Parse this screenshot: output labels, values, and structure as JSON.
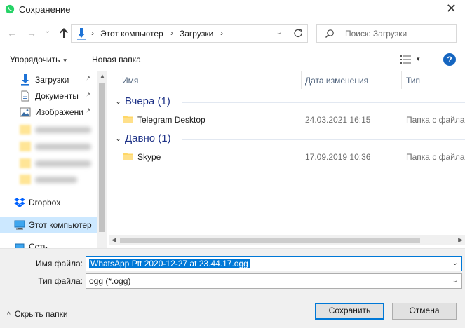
{
  "window": {
    "title": "Сохранение",
    "close_glyph": "✕",
    "app_icon": "whatsapp-icon"
  },
  "nav": {
    "back_glyph": "←",
    "forward_glyph": "→",
    "history_glyph": "⌄",
    "up_icon": "arrow-up-icon",
    "breadcrumb_sep": "›",
    "breadcrumbs": [
      "Этот компьютер",
      "Загрузки"
    ],
    "address_dropdown_glyph": "⌄",
    "search_placeholder": "Поиск: Загрузки"
  },
  "toolbar": {
    "organize_label": "Упорядочить",
    "new_folder_label": "Новая папка",
    "dropdown_glyph": "▾",
    "help_label": "?"
  },
  "sidebar": {
    "quick_access": [
      {
        "label": "Загрузки",
        "icon": "download-arrow-icon",
        "pinned": true
      },
      {
        "label": "Документы",
        "icon": "document-icon",
        "pinned": true
      },
      {
        "label": "Изображени",
        "icon": "picture-icon",
        "pinned": true
      }
    ],
    "pin_glyph": "📌",
    "dropbox_label": "Dropbox",
    "this_pc_label": "Этот компьютер",
    "network_label": "Сеть",
    "scroll_up_glyph": "▲"
  },
  "file_list": {
    "columns": {
      "name": "Имя",
      "date": "Дата изменения",
      "type": "Тип"
    },
    "sort_glyph": "⌃",
    "group_chevron_glyph": "⌄",
    "groups": [
      {
        "label": "Вчера (1)",
        "items": [
          {
            "name": "Telegram Desktop",
            "date": "24.03.2021 16:15",
            "type": "Папка с файлами"
          }
        ]
      },
      {
        "label": "Давно (1)",
        "items": [
          {
            "name": "Skype",
            "date": "17.09.2019 10:36",
            "type": "Папка с файлами"
          }
        ]
      }
    ],
    "scroll_left_glyph": "◀",
    "scroll_right_glyph": "▶"
  },
  "save_form": {
    "filename_label": "Имя файла:",
    "filename_value": "WhatsApp Ptt 2020-12-27 at 23.44.17.ogg",
    "filetype_label": "Тип файла:",
    "filetype_value": "ogg (*.ogg)",
    "dropdown_glyph": "⌄",
    "hide_folders_glyph": "^",
    "hide_folders_label": "Скрыть папки",
    "save_label": "Сохранить",
    "cancel_label": "Отмена"
  },
  "colors": {
    "accent": "#0078d7",
    "folder": "#ffd766",
    "group_header": "#1e3287",
    "selection": "#cce8ff"
  }
}
